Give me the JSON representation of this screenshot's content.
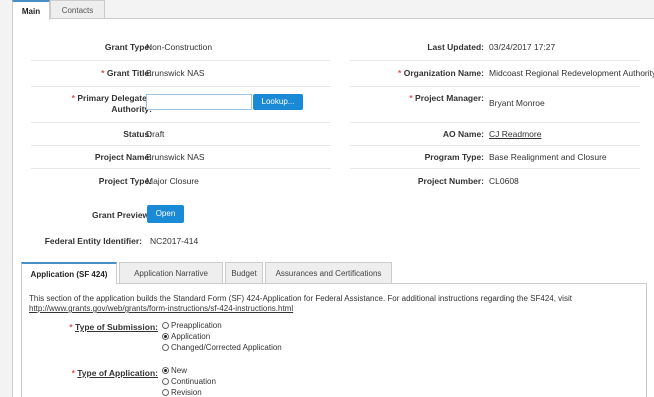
{
  "tabs": [
    {
      "label": "Main",
      "active": true
    },
    {
      "label": "Contacts",
      "active": false
    }
  ],
  "fields": {
    "grant_type": {
      "label": "Grant Type:",
      "value": "Non-Construction"
    },
    "last_updated": {
      "label": "Last Updated:",
      "value": "03/24/2017 17:27"
    },
    "grant_title": {
      "label": "Grant Title:",
      "value": "Brunswick NAS"
    },
    "organization_name": {
      "label": "Organization Name:",
      "value": "Midcoast Regional Redevelopment Authority"
    },
    "primary_delegated_authority": {
      "label_line1": "Primary Delegated",
      "label_line2": "Authority:",
      "value": ""
    },
    "lookup_button": "Lookup...",
    "project_manager": {
      "label": "Project Manager:",
      "value": "Bryant Monroe"
    },
    "status": {
      "label": "Status:",
      "value": "Draft"
    },
    "ao_name": {
      "label": "AO Name:",
      "value": "CJ Readmore"
    },
    "project_name": {
      "label": "Project Name:",
      "value": "Brunswick NAS"
    },
    "program_type": {
      "label": "Program Type:",
      "value": "Base Realignment and Closure"
    },
    "project_type": {
      "label": "Project Type:",
      "value": "Major Closure"
    },
    "project_number": {
      "label": "Project Number:",
      "value": "CL0608"
    },
    "grant_preview": {
      "label": "Grant Preview:",
      "button": "Open"
    },
    "federal_entity_identifier": {
      "label": "Federal Entity Identifier:",
      "value": "NC2017-414"
    }
  },
  "required_marker": "*",
  "sub_tabs": [
    {
      "label": "Application (SF 424)",
      "active": true
    },
    {
      "label": "Application Narrative",
      "active": false
    },
    {
      "label": "Budget",
      "active": false
    },
    {
      "label": "Assurances and Certifications",
      "active": false
    }
  ],
  "sf424": {
    "intro": "This section of the application builds the Standard Form (SF) 424-Application for Federal Assistance. For additional instructions regarding the SF424, visit",
    "link": "http://www.grants.gov/web/grants/form-instructions/sf-424-instructions.html",
    "type_of_submission": {
      "label": "Type of Submission:",
      "options": [
        {
          "label": "Preapplication",
          "selected": false
        },
        {
          "label": "Application",
          "selected": true
        },
        {
          "label": "Changed/Corrected Application",
          "selected": false
        }
      ]
    },
    "type_of_application": {
      "label": "Type of Application:",
      "options": [
        {
          "label": "New",
          "selected": true
        },
        {
          "label": "Continuation",
          "selected": false
        },
        {
          "label": "Revision",
          "selected": false
        }
      ]
    }
  },
  "colors": {
    "accent_blue": "#1a8ad6",
    "required_red": "#d9534f",
    "tab_active_border": "#4a90c8"
  }
}
